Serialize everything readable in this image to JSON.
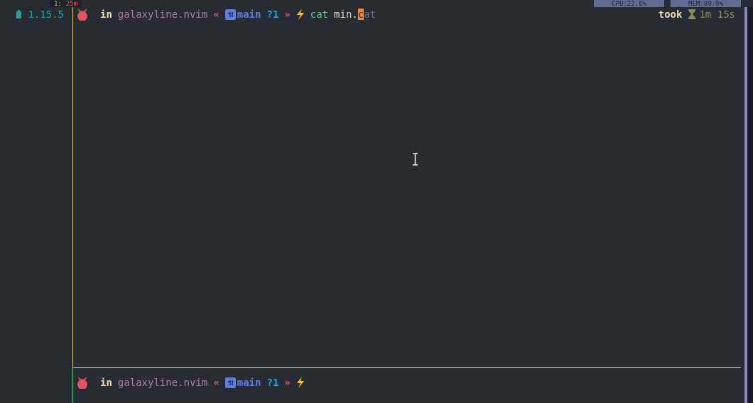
{
  "top_bar": {
    "tab_index": "1:",
    "tab_time": "25m",
    "cpu": "CPU:22.6%",
    "mem": "MEM:89.9%"
  },
  "gutter": {
    "version": "1.15.5"
  },
  "prompts": [
    {
      "kind": "active",
      "in": "in",
      "dir": "galaxyline.nvim",
      "open": "«",
      "branch": "main",
      "status": "?1",
      "close": "»",
      "command": "cat",
      "argument": "min.",
      "cursor_char": "c",
      "suggestion": "at",
      "took": "took",
      "duration": "1m 15s"
    },
    {
      "kind": "pending",
      "in": "in",
      "dir": "galaxyline.nvim",
      "open": "«",
      "branch": "main",
      "status": "?1",
      "close": "»"
    }
  ]
}
